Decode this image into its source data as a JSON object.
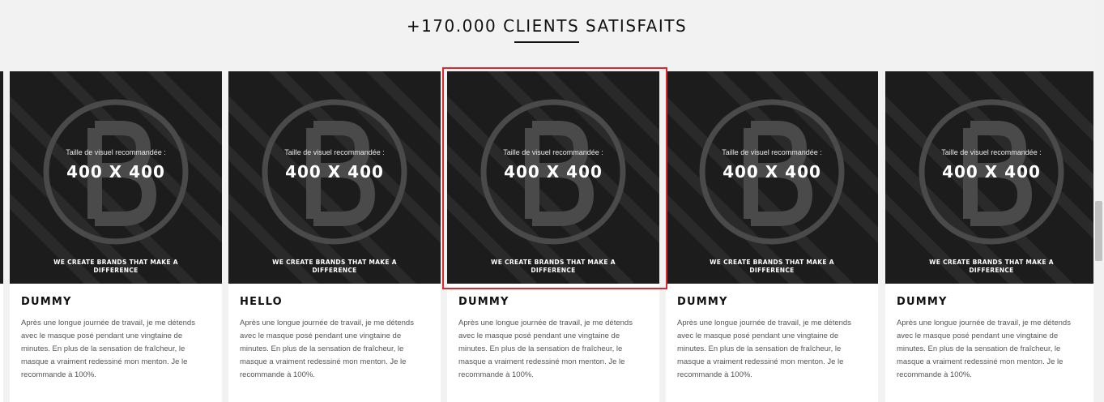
{
  "section": {
    "title": "+170.000 CLIENTS SATISFAITS"
  },
  "card_image": {
    "caption": "Taille de visuel recommandée :",
    "size": "400 X 400",
    "tagline": "WE CREATE BRANDS THAT MAKE A DIFFERENCE"
  },
  "testimonials": [
    {
      "name": "DUMMY",
      "text": "Après une longue journée de travail, je me détends avec le masque posé pendant une vingtaine de minutes. En plus de la sensation de fraîcheur, le masque a vraiment redessiné mon menton. Je le recommande à 100%."
    },
    {
      "name": "HELLO",
      "text": "Après une longue journée de travail, je me détends avec le masque posé pendant une vingtaine de minutes. En plus de la sensation de fraîcheur, le masque a vraiment redessiné mon menton. Je le recommande à 100%."
    },
    {
      "name": "DUMMY",
      "text": "Après une longue journée de travail, je me détends avec le masque posé pendant une vingtaine de minutes. En plus de la sensation de fraîcheur, le masque a vraiment redessiné mon menton. Je le recommande à 100%."
    },
    {
      "name": "DUMMY",
      "text": "Après une longue journée de travail, je me détends avec le masque posé pendant une vingtaine de minutes. En plus de la sensation de fraîcheur, le masque a vraiment redessiné mon menton. Je le recommande à 100%."
    },
    {
      "name": "DUMMY",
      "text": "Après une longue journée de travail, je me détends avec le masque posé pendant une vingtaine de minutes. En plus de la sensation de fraîcheur, le masque a vraiment redessiné mon menton. Je le recommande à 100%."
    }
  ],
  "colors": {
    "background": "#f2f2f2",
    "card_background": "#ffffff",
    "image_background": "#1c1c1c",
    "highlight": "#e3262a",
    "title": "#111111",
    "body_text": "#555555"
  },
  "icons": {
    "image_emblem": "circled-b-logo-icon"
  }
}
